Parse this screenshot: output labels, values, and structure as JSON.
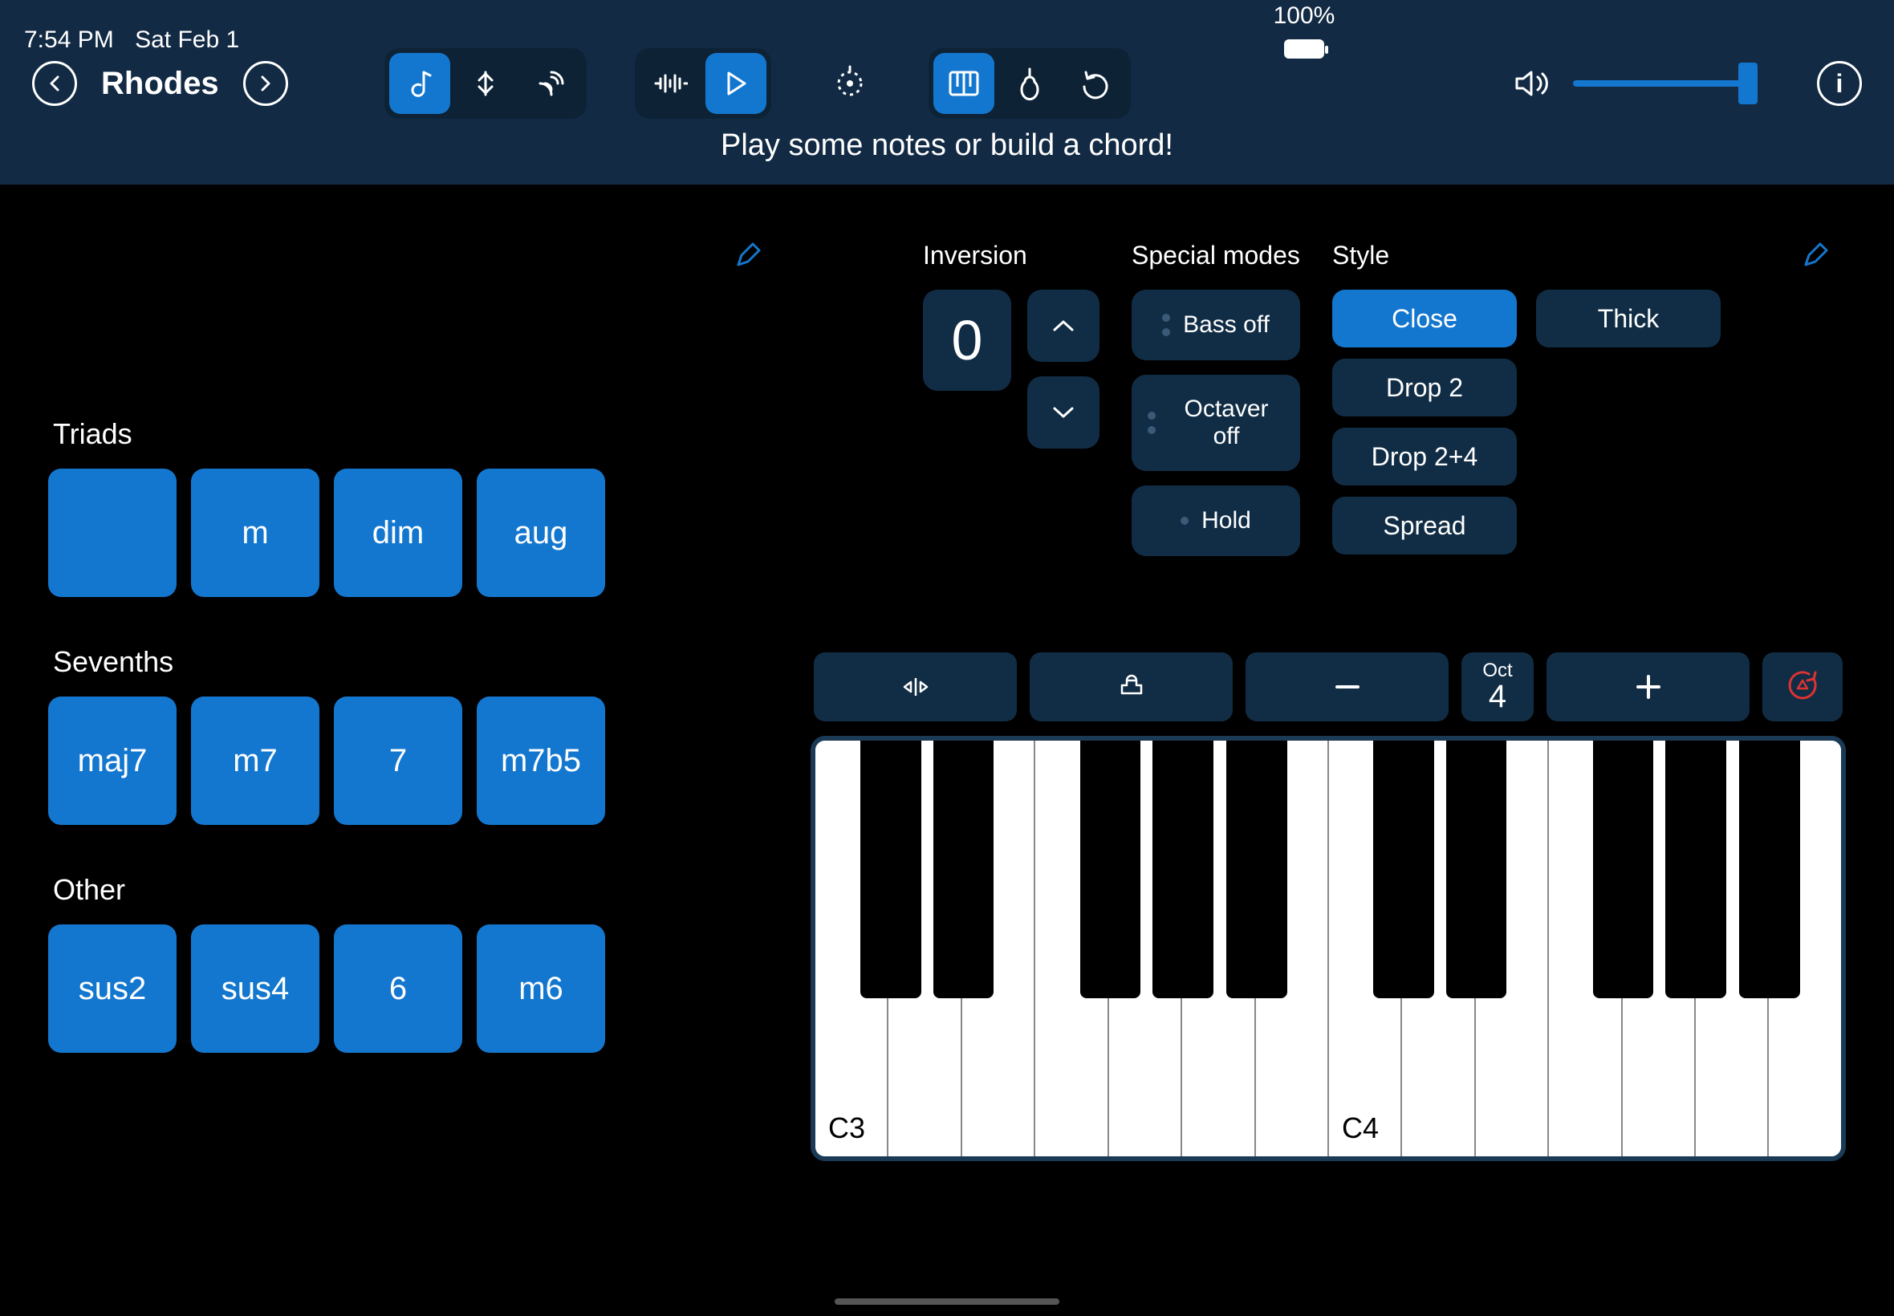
{
  "status": {
    "time": "7:54 PM",
    "date": "Sat Feb 1",
    "battery": "100%"
  },
  "toolbar": {
    "sound_name": "Rhodes",
    "hint": "Play some notes or build a chord!"
  },
  "controls": {
    "inversion_label": "Inversion",
    "inversion_value": "0",
    "special_label": "Special modes",
    "special": {
      "bass": "Bass off",
      "octaver": "Octaver off",
      "hold": "Hold"
    },
    "style_label": "Style",
    "styles": {
      "close": "Close",
      "thick": "Thick",
      "drop2": "Drop 2",
      "drop24": "Drop 2+4",
      "spread": "Spread"
    }
  },
  "chords": {
    "triads_label": "Triads",
    "triads": [
      "",
      "m",
      "dim",
      "aug"
    ],
    "sevenths_label": "Sevenths",
    "sevenths": [
      "maj7",
      "m7",
      "7",
      "m7b5"
    ],
    "other_label": "Other",
    "other": [
      "sus2",
      "sus4",
      "6",
      "m6"
    ]
  },
  "keyboard": {
    "oct_label": "Oct",
    "oct_value": "4",
    "c3": "C3",
    "c4": "C4"
  }
}
